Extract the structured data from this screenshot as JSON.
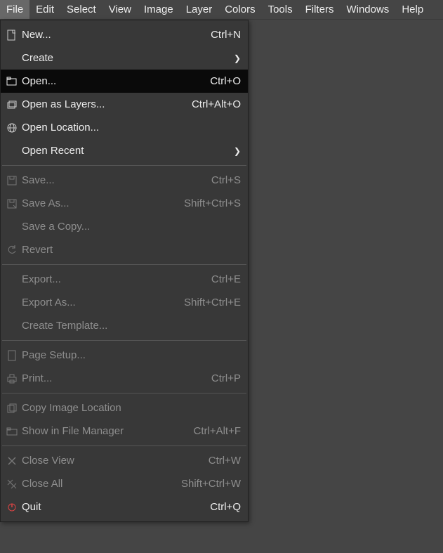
{
  "menubar": {
    "items": [
      {
        "label": "File"
      },
      {
        "label": "Edit"
      },
      {
        "label": "Select"
      },
      {
        "label": "View"
      },
      {
        "label": "Image"
      },
      {
        "label": "Layer"
      },
      {
        "label": "Colors"
      },
      {
        "label": "Tools"
      },
      {
        "label": "Filters"
      },
      {
        "label": "Windows"
      },
      {
        "label": "Help"
      }
    ],
    "active_index": 0
  },
  "file_menu": {
    "items": [
      {
        "icon": "file-new-icon",
        "label": "New...",
        "shortcut": "Ctrl+N",
        "enabled": true
      },
      {
        "icon": "",
        "label": "Create",
        "submenu": true,
        "enabled": true
      },
      {
        "icon": "folder-open-icon",
        "label": "Open...",
        "shortcut": "Ctrl+O",
        "enabled": true,
        "highlighted": true
      },
      {
        "icon": "layer-open-icon",
        "label": "Open as Layers...",
        "shortcut": "Ctrl+Alt+O",
        "enabled": true
      },
      {
        "icon": "globe-icon",
        "label": "Open Location...",
        "enabled": true
      },
      {
        "icon": "",
        "label": "Open Recent",
        "submenu": true,
        "enabled": true
      },
      {
        "separator": true
      },
      {
        "icon": "save-icon",
        "label": "Save...",
        "shortcut": "Ctrl+S",
        "enabled": false
      },
      {
        "icon": "save-as-icon",
        "label": "Save As...",
        "shortcut": "Shift+Ctrl+S",
        "enabled": false
      },
      {
        "icon": "",
        "label": "Save a Copy...",
        "enabled": false
      },
      {
        "icon": "revert-icon",
        "label": "Revert",
        "enabled": false
      },
      {
        "separator": true
      },
      {
        "icon": "",
        "label": "Export...",
        "shortcut": "Ctrl+E",
        "enabled": false
      },
      {
        "icon": "",
        "label": "Export As...",
        "shortcut": "Shift+Ctrl+E",
        "enabled": false
      },
      {
        "icon": "",
        "label": "Create Template...",
        "enabled": false
      },
      {
        "separator": true
      },
      {
        "icon": "page-setup-icon",
        "label": "Page Setup...",
        "enabled": false
      },
      {
        "icon": "print-icon",
        "label": "Print...",
        "shortcut": "Ctrl+P",
        "enabled": false
      },
      {
        "separator": true
      },
      {
        "icon": "copy-icon",
        "label": "Copy Image Location",
        "enabled": false
      },
      {
        "icon": "folder-icon",
        "label": "Show in File Manager",
        "shortcut": "Ctrl+Alt+F",
        "enabled": false
      },
      {
        "separator": true
      },
      {
        "icon": "close-icon",
        "label": "Close View",
        "shortcut": "Ctrl+W",
        "enabled": false
      },
      {
        "icon": "close-all-icon",
        "label": "Close All",
        "shortcut": "Shift+Ctrl+W",
        "enabled": false
      },
      {
        "icon": "quit-icon",
        "label": "Quit",
        "shortcut": "Ctrl+Q",
        "enabled": true
      }
    ]
  }
}
